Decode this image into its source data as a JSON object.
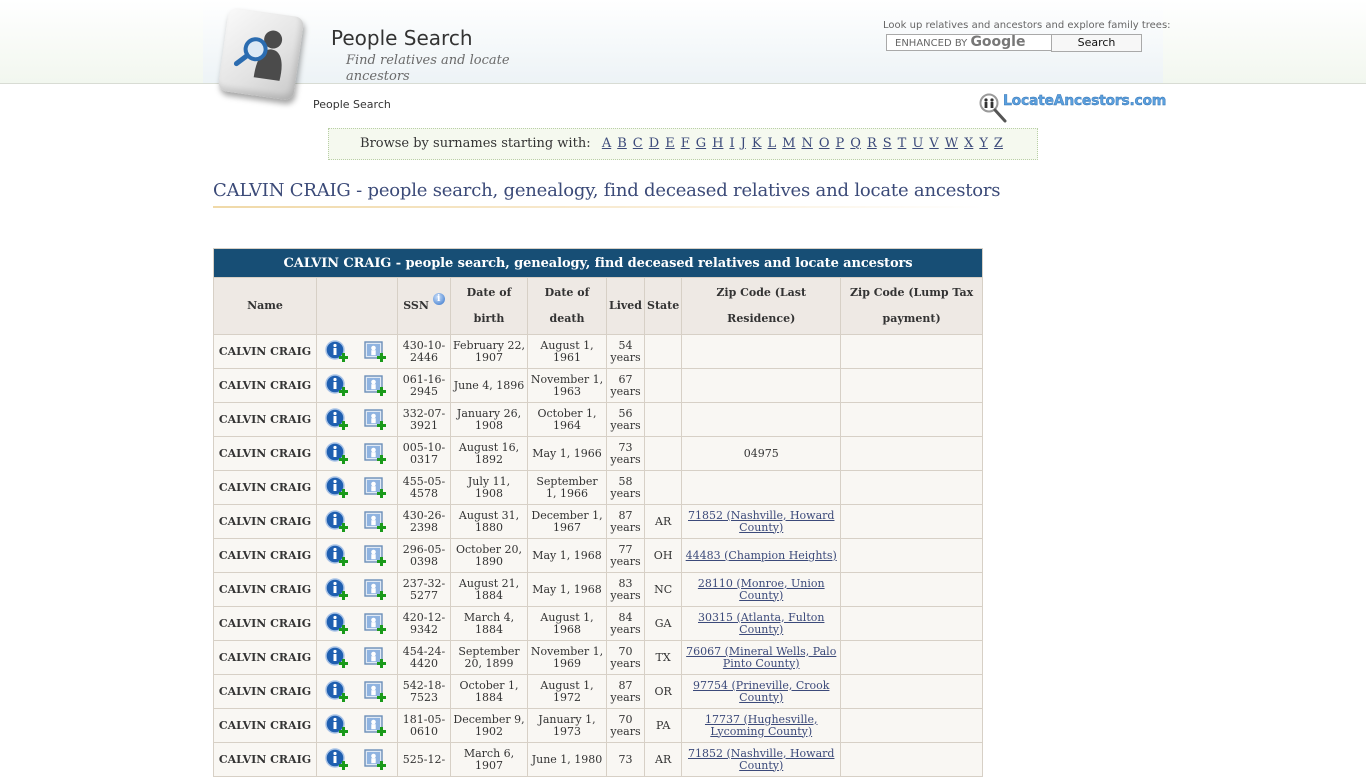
{
  "header": {
    "site_title": "People Search",
    "tagline": "Find relatives and locate ancestors",
    "breadcrumb": "People Search",
    "search_hint": "Look up relatives and ancestors and explore family trees:",
    "search_placeholder_prefix": "ENHANCED BY",
    "search_placeholder_brand": "Google",
    "search_button": "Search",
    "partner_logo_text": "LocateAncestors.com"
  },
  "browse": {
    "label": "Browse by surnames starting with:",
    "letters": [
      "A",
      "B",
      "C",
      "D",
      "E",
      "F",
      "G",
      "H",
      "I",
      "J",
      "K",
      "L",
      "M",
      "N",
      "O",
      "P",
      "Q",
      "R",
      "S",
      "T",
      "U",
      "V",
      "W",
      "X",
      "Y",
      "Z"
    ]
  },
  "page_heading": "CALVIN CRAIG - people search, genealogy, find deceased relatives and locate ancestors",
  "table": {
    "caption": "CALVIN CRAIG - people search, genealogy, find deceased relatives and locate ancestors",
    "columns": [
      "Name",
      "",
      "SSN",
      "Date of birth",
      "Date of death",
      "Lived",
      "State",
      "Zip Code (Last Residence)",
      "Zip Code (Lump Tax payment)"
    ],
    "rows": [
      {
        "name": "CALVIN CRAIG",
        "ssn": "430-10-2446",
        "dob": "February 22, 1907",
        "dod": "August 1, 1961",
        "lived": "54 years",
        "state": "",
        "zip": "",
        "zip_link": false,
        "lump": ""
      },
      {
        "name": "CALVIN CRAIG",
        "ssn": "061-16-2945",
        "dob": "June 4, 1896",
        "dod": "November 1, 1963",
        "lived": "67 years",
        "state": "",
        "zip": "",
        "zip_link": false,
        "lump": ""
      },
      {
        "name": "CALVIN CRAIG",
        "ssn": "332-07-3921",
        "dob": "January 26, 1908",
        "dod": "October 1, 1964",
        "lived": "56 years",
        "state": "",
        "zip": "",
        "zip_link": false,
        "lump": ""
      },
      {
        "name": "CALVIN CRAIG",
        "ssn": "005-10-0317",
        "dob": "August 16, 1892",
        "dod": "May 1, 1966",
        "lived": "73 years",
        "state": "",
        "zip": "04975",
        "zip_link": false,
        "lump": ""
      },
      {
        "name": "CALVIN CRAIG",
        "ssn": "455-05-4578",
        "dob": "July 11, 1908",
        "dod": "September 1, 1966",
        "lived": "58 years",
        "state": "",
        "zip": "",
        "zip_link": false,
        "lump": ""
      },
      {
        "name": "CALVIN CRAIG",
        "ssn": "430-26-2398",
        "dob": "August 31, 1880",
        "dod": "December 1, 1967",
        "lived": "87 years",
        "state": "AR",
        "zip": "71852 (Nashville, Howard County)",
        "zip_link": true,
        "lump": ""
      },
      {
        "name": "CALVIN CRAIG",
        "ssn": "296-05-0398",
        "dob": "October 20, 1890",
        "dod": "May 1, 1968",
        "lived": "77 years",
        "state": "OH",
        "zip": "44483 (Champion Heights)",
        "zip_link": true,
        "lump": ""
      },
      {
        "name": "CALVIN CRAIG",
        "ssn": "237-32-5277",
        "dob": "August 21, 1884",
        "dod": "May 1, 1968",
        "lived": "83 years",
        "state": "NC",
        "zip": "28110 (Monroe, Union County)",
        "zip_link": true,
        "lump": ""
      },
      {
        "name": "CALVIN CRAIG",
        "ssn": "420-12-9342",
        "dob": "March 4, 1884",
        "dod": "August 1, 1968",
        "lived": "84 years",
        "state": "GA",
        "zip": "30315 (Atlanta, Fulton County)",
        "zip_link": true,
        "lump": ""
      },
      {
        "name": "CALVIN CRAIG",
        "ssn": "454-24-4420",
        "dob": "September 20, 1899",
        "dod": "November 1, 1969",
        "lived": "70 years",
        "state": "TX",
        "zip": "76067 (Mineral Wells, Palo Pinto County)",
        "zip_link": true,
        "lump": ""
      },
      {
        "name": "CALVIN CRAIG",
        "ssn": "542-18-7523",
        "dob": "October 1, 1884",
        "dod": "August 1, 1972",
        "lived": "87 years",
        "state": "OR",
        "zip": "97754 (Prineville, Crook County)",
        "zip_link": true,
        "lump": ""
      },
      {
        "name": "CALVIN CRAIG",
        "ssn": "181-05-0610",
        "dob": "December 9, 1902",
        "dod": "January 1, 1973",
        "lived": "70 years",
        "state": "PA",
        "zip": "17737 (Hughesville, Lycoming County)",
        "zip_link": true,
        "lump": ""
      },
      {
        "name": "CALVIN CRAIG",
        "ssn": "525-12-",
        "dob": "March 6, 1907",
        "dod": "June 1, 1980",
        "lived": "73",
        "state": "AR",
        "zip": "71852 (Nashville, Howard County)",
        "zip_link": true,
        "lump": ""
      }
    ]
  },
  "colors": {
    "caption_bg": "#174e75",
    "header_bg": "#eee9e4",
    "row_bg": "#f9f7f3",
    "link": "#3c4a7a",
    "heading": "#3b4a78"
  }
}
